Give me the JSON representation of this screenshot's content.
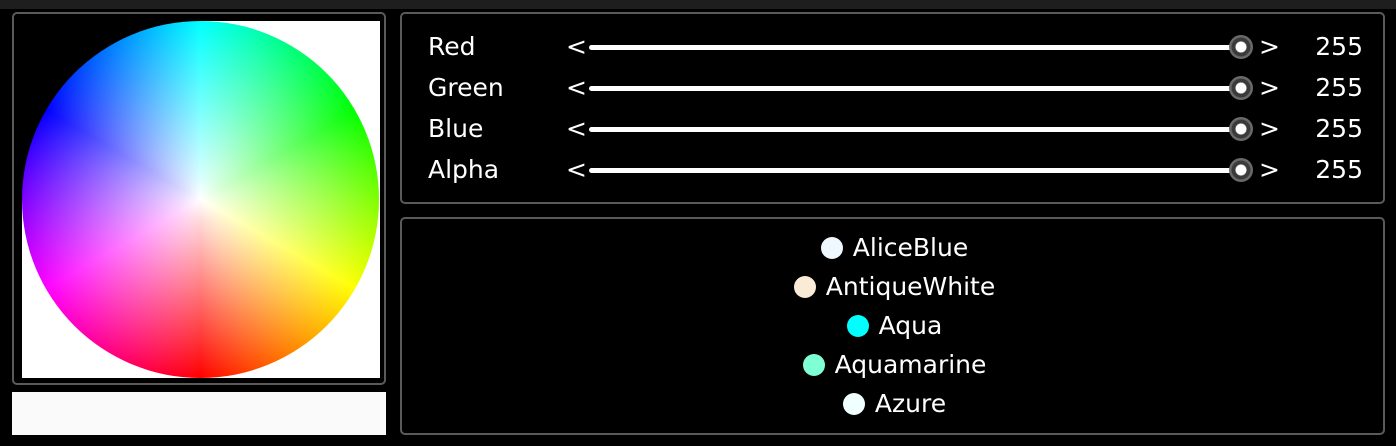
{
  "colors": {
    "panel_border": "#5a5a5a",
    "background": "#000000",
    "preview": "#fafafa"
  },
  "sliders": [
    {
      "label": "Red",
      "value": "255",
      "less": "<",
      "more": ">",
      "level": 1.0
    },
    {
      "label": "Green",
      "value": "255",
      "less": "<",
      "more": ">",
      "level": 1.0
    },
    {
      "label": "Blue",
      "value": "255",
      "less": "<",
      "more": ">",
      "level": 1.0
    },
    {
      "label": "Alpha",
      "value": "255",
      "less": "<",
      "more": ">",
      "level": 1.0
    }
  ],
  "color_list": [
    {
      "name": "AliceBlue",
      "swatch": "#f0f8ff"
    },
    {
      "name": "AntiqueWhite",
      "swatch": "#faebd7"
    },
    {
      "name": "Aqua",
      "swatch": "#00ffff"
    },
    {
      "name": "Aquamarine",
      "swatch": "#7fffd4"
    },
    {
      "name": "Azure",
      "swatch": "#f0ffff"
    }
  ]
}
